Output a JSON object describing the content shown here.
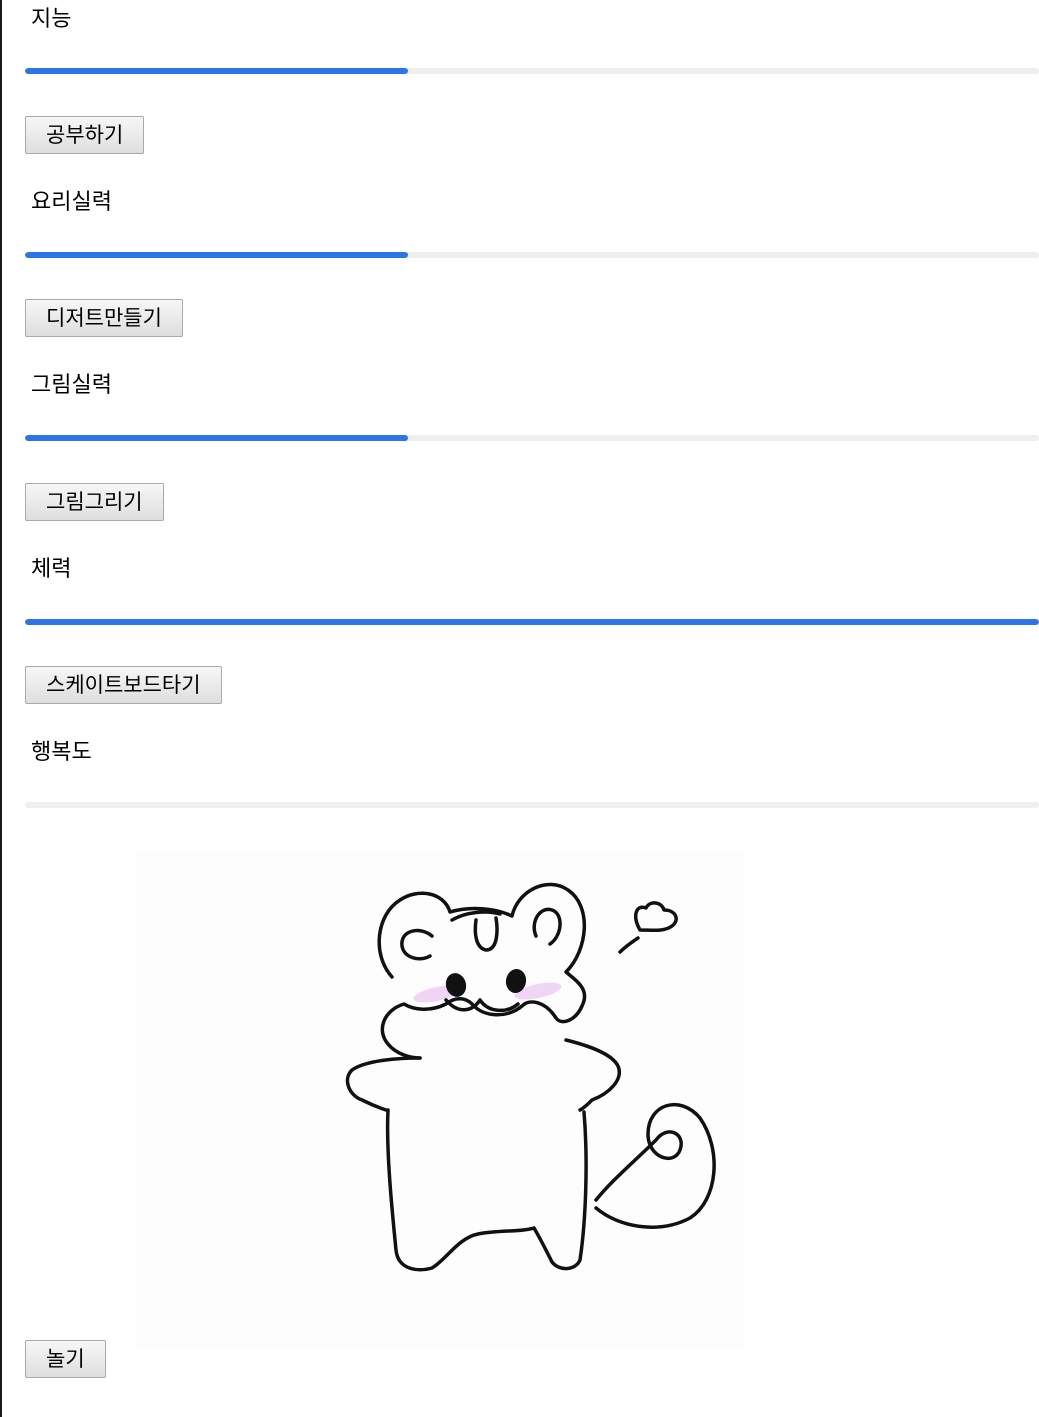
{
  "stats": [
    {
      "label": "지능",
      "level": 0.378,
      "button": "공부하기"
    },
    {
      "label": "요리실력",
      "level": 0.378,
      "button": "디저트만들기"
    },
    {
      "label": "그림실력",
      "level": 0.378,
      "button": "그림그리기"
    },
    {
      "label": "체력",
      "level": 1.0,
      "button": "스케이트보드타기"
    },
    {
      "label": "행복도",
      "level": 0.0,
      "button": "놀기"
    }
  ],
  "pet": {
    "icon": "hamster-character-drawing"
  },
  "colors": {
    "accent": "#2d74e6",
    "track": "#efefef",
    "blush": "#e8b4f0"
  }
}
